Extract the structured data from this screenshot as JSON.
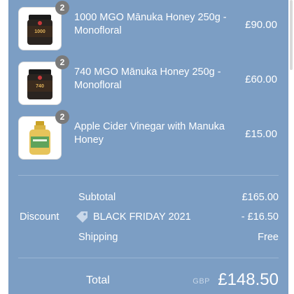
{
  "items": [
    {
      "name": "1000 MGO Mānuka Honey 250g - Monofloral",
      "price": "£90.00",
      "quantity": "2",
      "product_image": "dark-honey-jar-1000"
    },
    {
      "name": "740 MGO Mānuka Honey 250g - Monofloral",
      "price": "£60.00",
      "quantity": "2",
      "product_image": "dark-honey-jar-740"
    },
    {
      "name": "Apple Cider Vinegar with Manuka Honey",
      "price": "£15.00",
      "quantity": "2",
      "product_image": "vinegar-bottle"
    }
  ],
  "summary": {
    "subtotal_label": "Subtotal",
    "subtotal_value": "£165.00",
    "discount_label": "Discount",
    "discount_code": "BLACK FRIDAY 2021",
    "discount_value": "- £16.50",
    "shipping_label": "Shipping",
    "shipping_value": "Free",
    "total_label": "Total",
    "currency": "GBP",
    "total_value": "£148.50"
  },
  "colors": {
    "panel_background": "#7c9ec4",
    "badge": "#7a7a7a",
    "text": "#ffffff"
  }
}
